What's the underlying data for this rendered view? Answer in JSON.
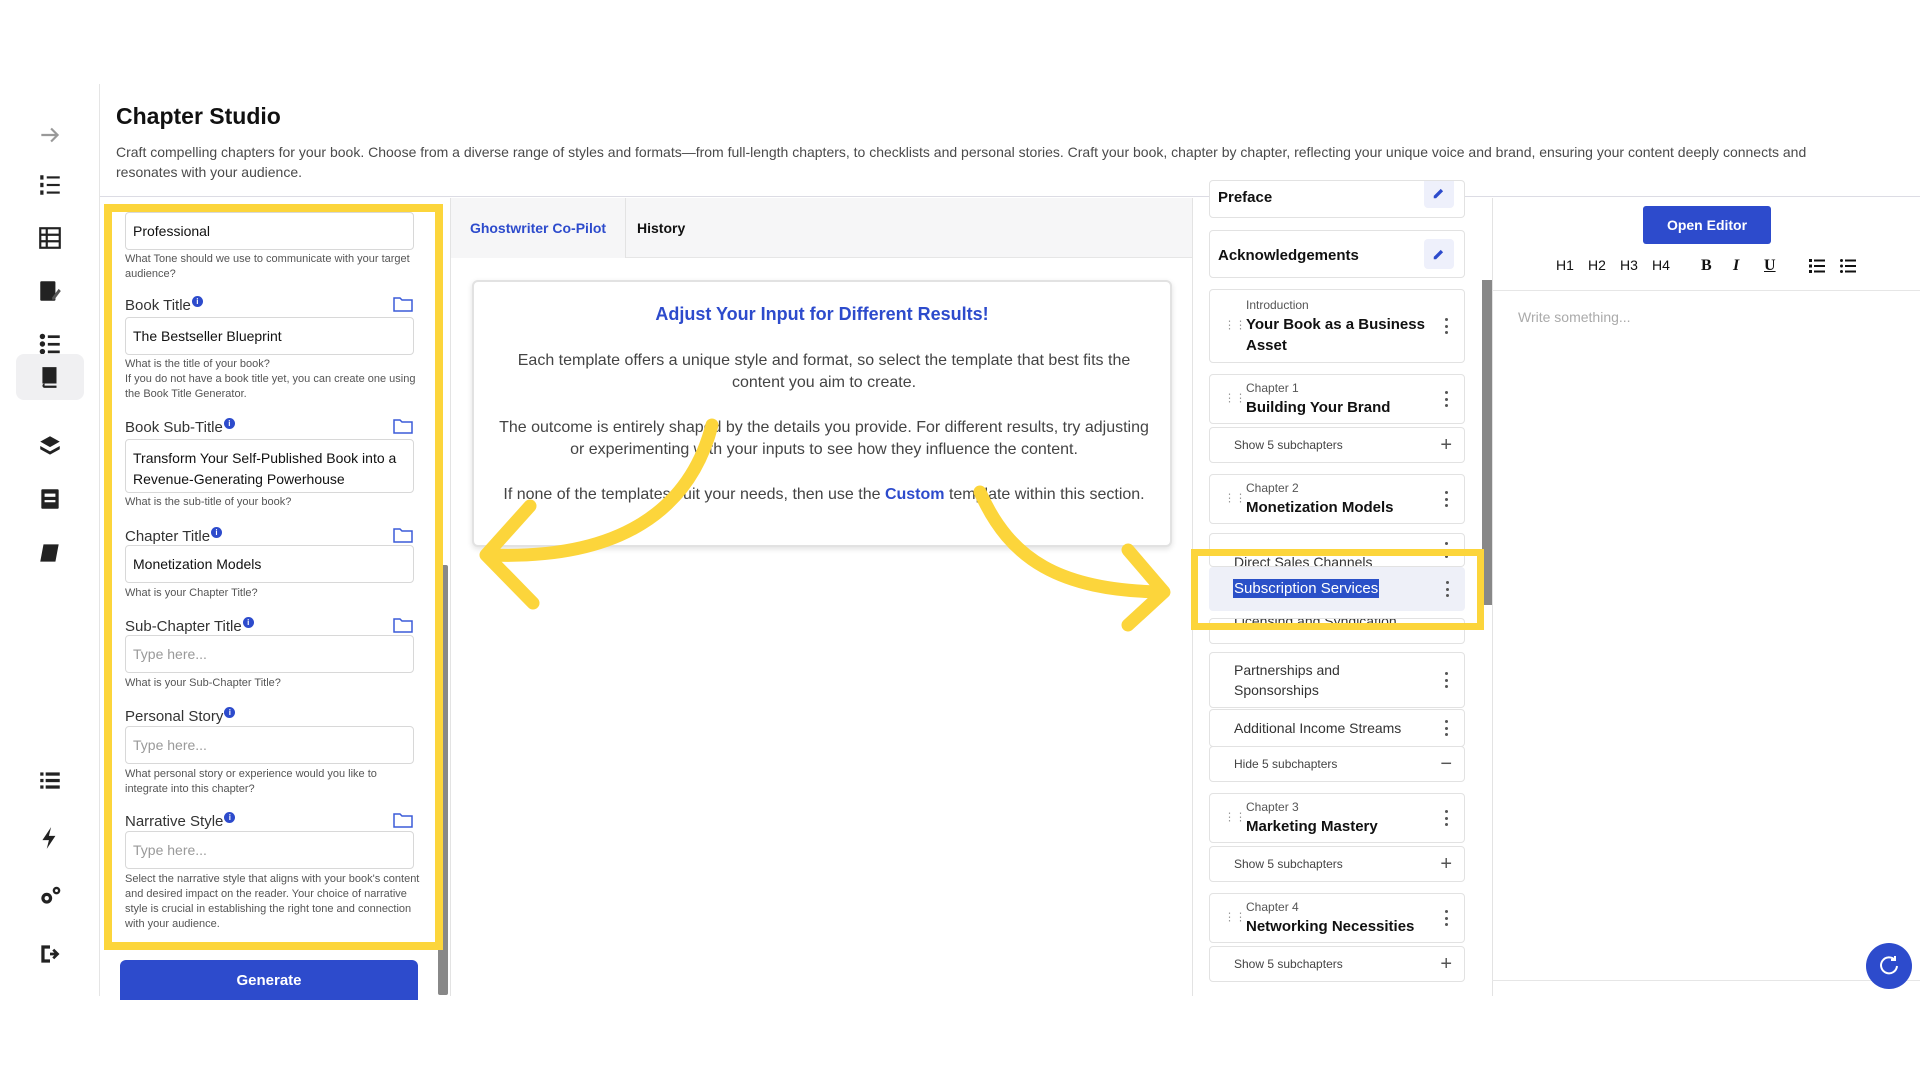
{
  "header": {
    "title": "Chapter Studio",
    "description": "Craft compelling chapters for your book. Choose from a diverse range of styles and formats—from full-length chapters, to checklists and personal stories. Craft your book, chapter by chapter, reflecting your unique voice and brand, ensuring your content deeply connects and resonates with your audience."
  },
  "sidebar": {
    "icons": [
      "arrow-right-icon",
      "numbered-list-icon",
      "table-icon",
      "edit-document-icon",
      "checklist-icon",
      "book-icon",
      "books-stack-icon",
      "archive-icon",
      "notebook-icon",
      "list-icon",
      "lightning-icon",
      "settings-icon",
      "logout-icon"
    ]
  },
  "form": {
    "tone_value": "Professional",
    "tone_help": "What Tone should we use to communicate with your target audience?",
    "book_title_label": "Book Title",
    "book_title_value": "The Bestseller Blueprint",
    "book_title_help": "What is the title of your book?\nIf you do not have a book title yet, you can create one using the Book Title Generator.",
    "subtitle_label": "Book Sub-Title",
    "subtitle_value": "Transform Your Self-Published Book into a Revenue-Generating Powerhouse",
    "subtitle_help": "What is the sub-title of your book?",
    "chapter_title_label": "Chapter Title",
    "chapter_title_value": "Monetization Models",
    "chapter_title_help": "What is your Chapter Title?",
    "subchapter_label": "Sub-Chapter Title",
    "subchapter_placeholder": "Type here...",
    "subchapter_help": "What is your Sub-Chapter Title?",
    "story_label": "Personal Story",
    "story_placeholder": "Type here...",
    "story_help": "What personal story or experience would you like to integrate into this chapter?",
    "narrative_label": "Narrative Style",
    "narrative_placeholder": "Type here...",
    "narrative_help": "Select the narrative style that aligns with your book's content and desired impact on the reader. Your choice of narrative style is crucial in establishing the right tone and connection with your audience.",
    "generate_label": "Generate"
  },
  "tabs": {
    "copilot": "Ghostwriter Co-Pilot",
    "history": "History"
  },
  "info_card": {
    "title": "Adjust Your Input for Different Results!",
    "p1": "Each template offers a unique style and format, so select the template that best fits the content you aim to create.",
    "p2": "The outcome is entirely shaped by the details you provide. For different results, try adjusting or experimenting with your inputs to see how they influence the content.",
    "p3_before": "If none of the templates suit your needs, then use the ",
    "p3_link": "Custom",
    "p3_after": " template within this section."
  },
  "outline": {
    "preface": "Preface",
    "acknowledgements": "Acknowledgements",
    "intro_kicker": "Introduction",
    "intro_title": "Your Book as a Business Asset",
    "ch1_kicker": "Chapter 1",
    "ch1_title": "Building Your Brand",
    "ch1_toggle": "Show 5 subchapters",
    "ch2_kicker": "Chapter 2",
    "ch2_title": "Monetization Models",
    "ch2_subs": [
      "Direct Sales Channels",
      "Subscription Services",
      "Licensing and Syndication",
      "Partnerships and Sponsorships",
      "Additional Income Streams"
    ],
    "ch2_toggle": "Hide 5 subchapters",
    "ch3_kicker": "Chapter 3",
    "ch3_title": "Marketing Mastery",
    "ch3_toggle": "Show 5 subchapters",
    "ch4_kicker": "Chapter 4",
    "ch4_title": "Networking Necessities",
    "ch4_toggle": "Show 5 subchapters"
  },
  "editor": {
    "open_label": "Open Editor",
    "toolbar": [
      "H1",
      "H2",
      "H3",
      "H4",
      "B",
      "I",
      "U"
    ],
    "placeholder": "Write something..."
  },
  "colors": {
    "accent": "#2d4bcc",
    "highlight": "#fcd53b"
  }
}
